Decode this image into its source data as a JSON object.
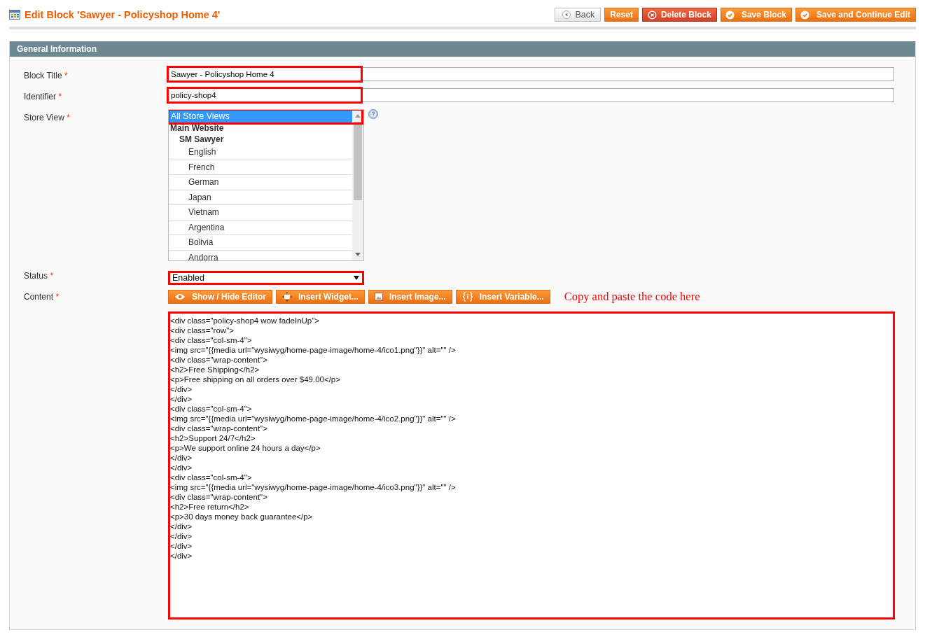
{
  "page_title": "Edit Block 'Sawyer - Policyshop Home 4'",
  "actions": [
    {
      "label": "Back",
      "kind": "back"
    },
    {
      "label": "Reset",
      "kind": "plain"
    },
    {
      "label": "Delete Block",
      "kind": "delete"
    },
    {
      "label": "Save Block",
      "kind": "save"
    },
    {
      "label": "Save and Continue Edit",
      "kind": "save"
    }
  ],
  "section": {
    "title": "General Information"
  },
  "fields": [
    {
      "label": "Block Title",
      "required_mark": "*",
      "kind": "text",
      "value": "Sawyer - Policyshop Home 4",
      "highlighted": true
    },
    {
      "label": "Identifier",
      "required_mark": "*",
      "kind": "text",
      "value": "policy-shop4",
      "highlighted": true
    },
    {
      "label": "Store View",
      "required_mark": "*",
      "kind": "multiselect",
      "highlighted": true,
      "options": [
        {
          "label": "All Store Views",
          "selected": true
        },
        {
          "label": "Main Website",
          "group": true,
          "children": [
            {
              "label": "SM Sawyer",
              "group": true,
              "children": [
                {
                  "label": "English",
                  "selected": false
                },
                {
                  "label": "French",
                  "selected": false
                },
                {
                  "label": "German",
                  "selected": false
                },
                {
                  "label": "Japan",
                  "selected": false
                },
                {
                  "label": "Vietnam",
                  "selected": false
                },
                {
                  "label": "Argentina",
                  "selected": false
                },
                {
                  "label": "Bolivia",
                  "selected": false
                },
                {
                  "label": "Andorra",
                  "selected": false
                }
              ]
            }
          ]
        }
      ]
    },
    {
      "label": "Status",
      "required_mark": "*",
      "kind": "select",
      "value": "Enabled",
      "highlighted": true
    },
    {
      "label": "Content",
      "required_mark": "*",
      "kind": "editor",
      "highlighted": true,
      "toolbar": [
        {
          "label": "Show / Hide Editor",
          "kind": "eye"
        },
        {
          "label": "Insert Widget...",
          "kind": "widget"
        },
        {
          "label": "Insert Image...",
          "kind": "image"
        },
        {
          "label": "Insert Variable...",
          "kind": "variable"
        }
      ],
      "note": "Copy and paste the code here",
      "value": "<div class=\"policy-shop4 wow fadeInUp\">\n<div class=\"row\">\n<div class=\"col-sm-4\">\n<img src=\"{{media url=\"wysiwyg/home-page-image/home-4/ico1.png\"}}\" alt=\"\" />\n<div class=\"wrap-content\">\n<h2>Free Shipping</h2>\n<p>Free shipping on all orders over $49.00</p>\n</div>\n</div>\n<div class=\"col-sm-4\">\n<img src=\"{{media url=\"wysiwyg/home-page-image/home-4/ico2.png\"}}\" alt=\"\" />\n<div class=\"wrap-content\">\n<h2>Support 24/7</h2>\n<p>We support online 24 hours a day</p>\n</div>\n</div>\n<div class=\"col-sm-4\">\n<img src=\"{{media url=\"wysiwyg/home-page-image/home-4/ico3.png\"}}\" alt=\"\" />\n<div class=\"wrap-content\">\n<h2>Free return</h2>\n<p>30 days money back guarantee</p>\n</div>\n</div>\n</div>\n</div>"
    }
  ]
}
